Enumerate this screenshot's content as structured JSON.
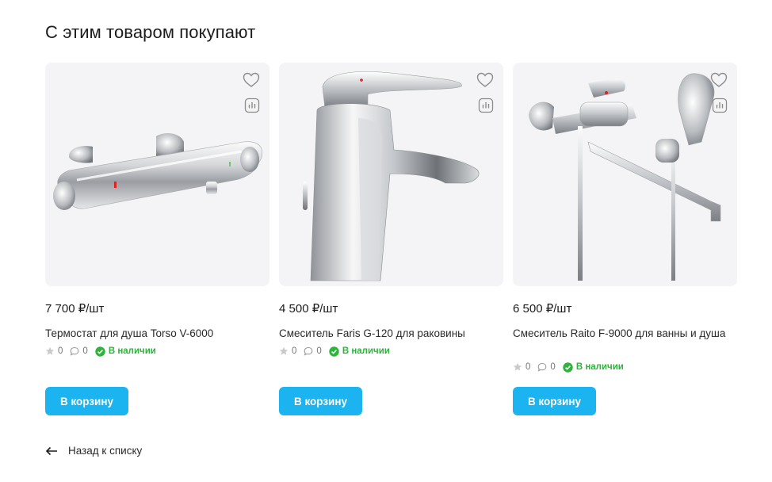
{
  "section": {
    "title": "С этим товаром покупают"
  },
  "products": [
    {
      "price": "7 700 ₽/шт",
      "name": "Термостат для душа Torso V-6000",
      "rating": "0",
      "reviews": "0",
      "stock": "В наличии",
      "cart_label": "В корзину",
      "image_icon": "shower-thermostat"
    },
    {
      "price": "4 500 ₽/шт",
      "name": "Смеситель Faris G-120 для раковины",
      "rating": "0",
      "reviews": "0",
      "stock": "В наличии",
      "cart_label": "В корзину",
      "image_icon": "basin-faucet"
    },
    {
      "price": "6 500 ₽/шт",
      "name": "Смеситель Raito F-9000 для ванны и душа",
      "rating": "0",
      "reviews": "0",
      "stock": "В наличии",
      "cart_label": "В корзину",
      "image_icon": "bath-shower-mixer"
    }
  ],
  "back": {
    "label": "Назад к списку"
  },
  "colors": {
    "accent": "#1bb3f0",
    "in_stock": "#2eb33c",
    "card_bg": "#f4f4f6"
  }
}
